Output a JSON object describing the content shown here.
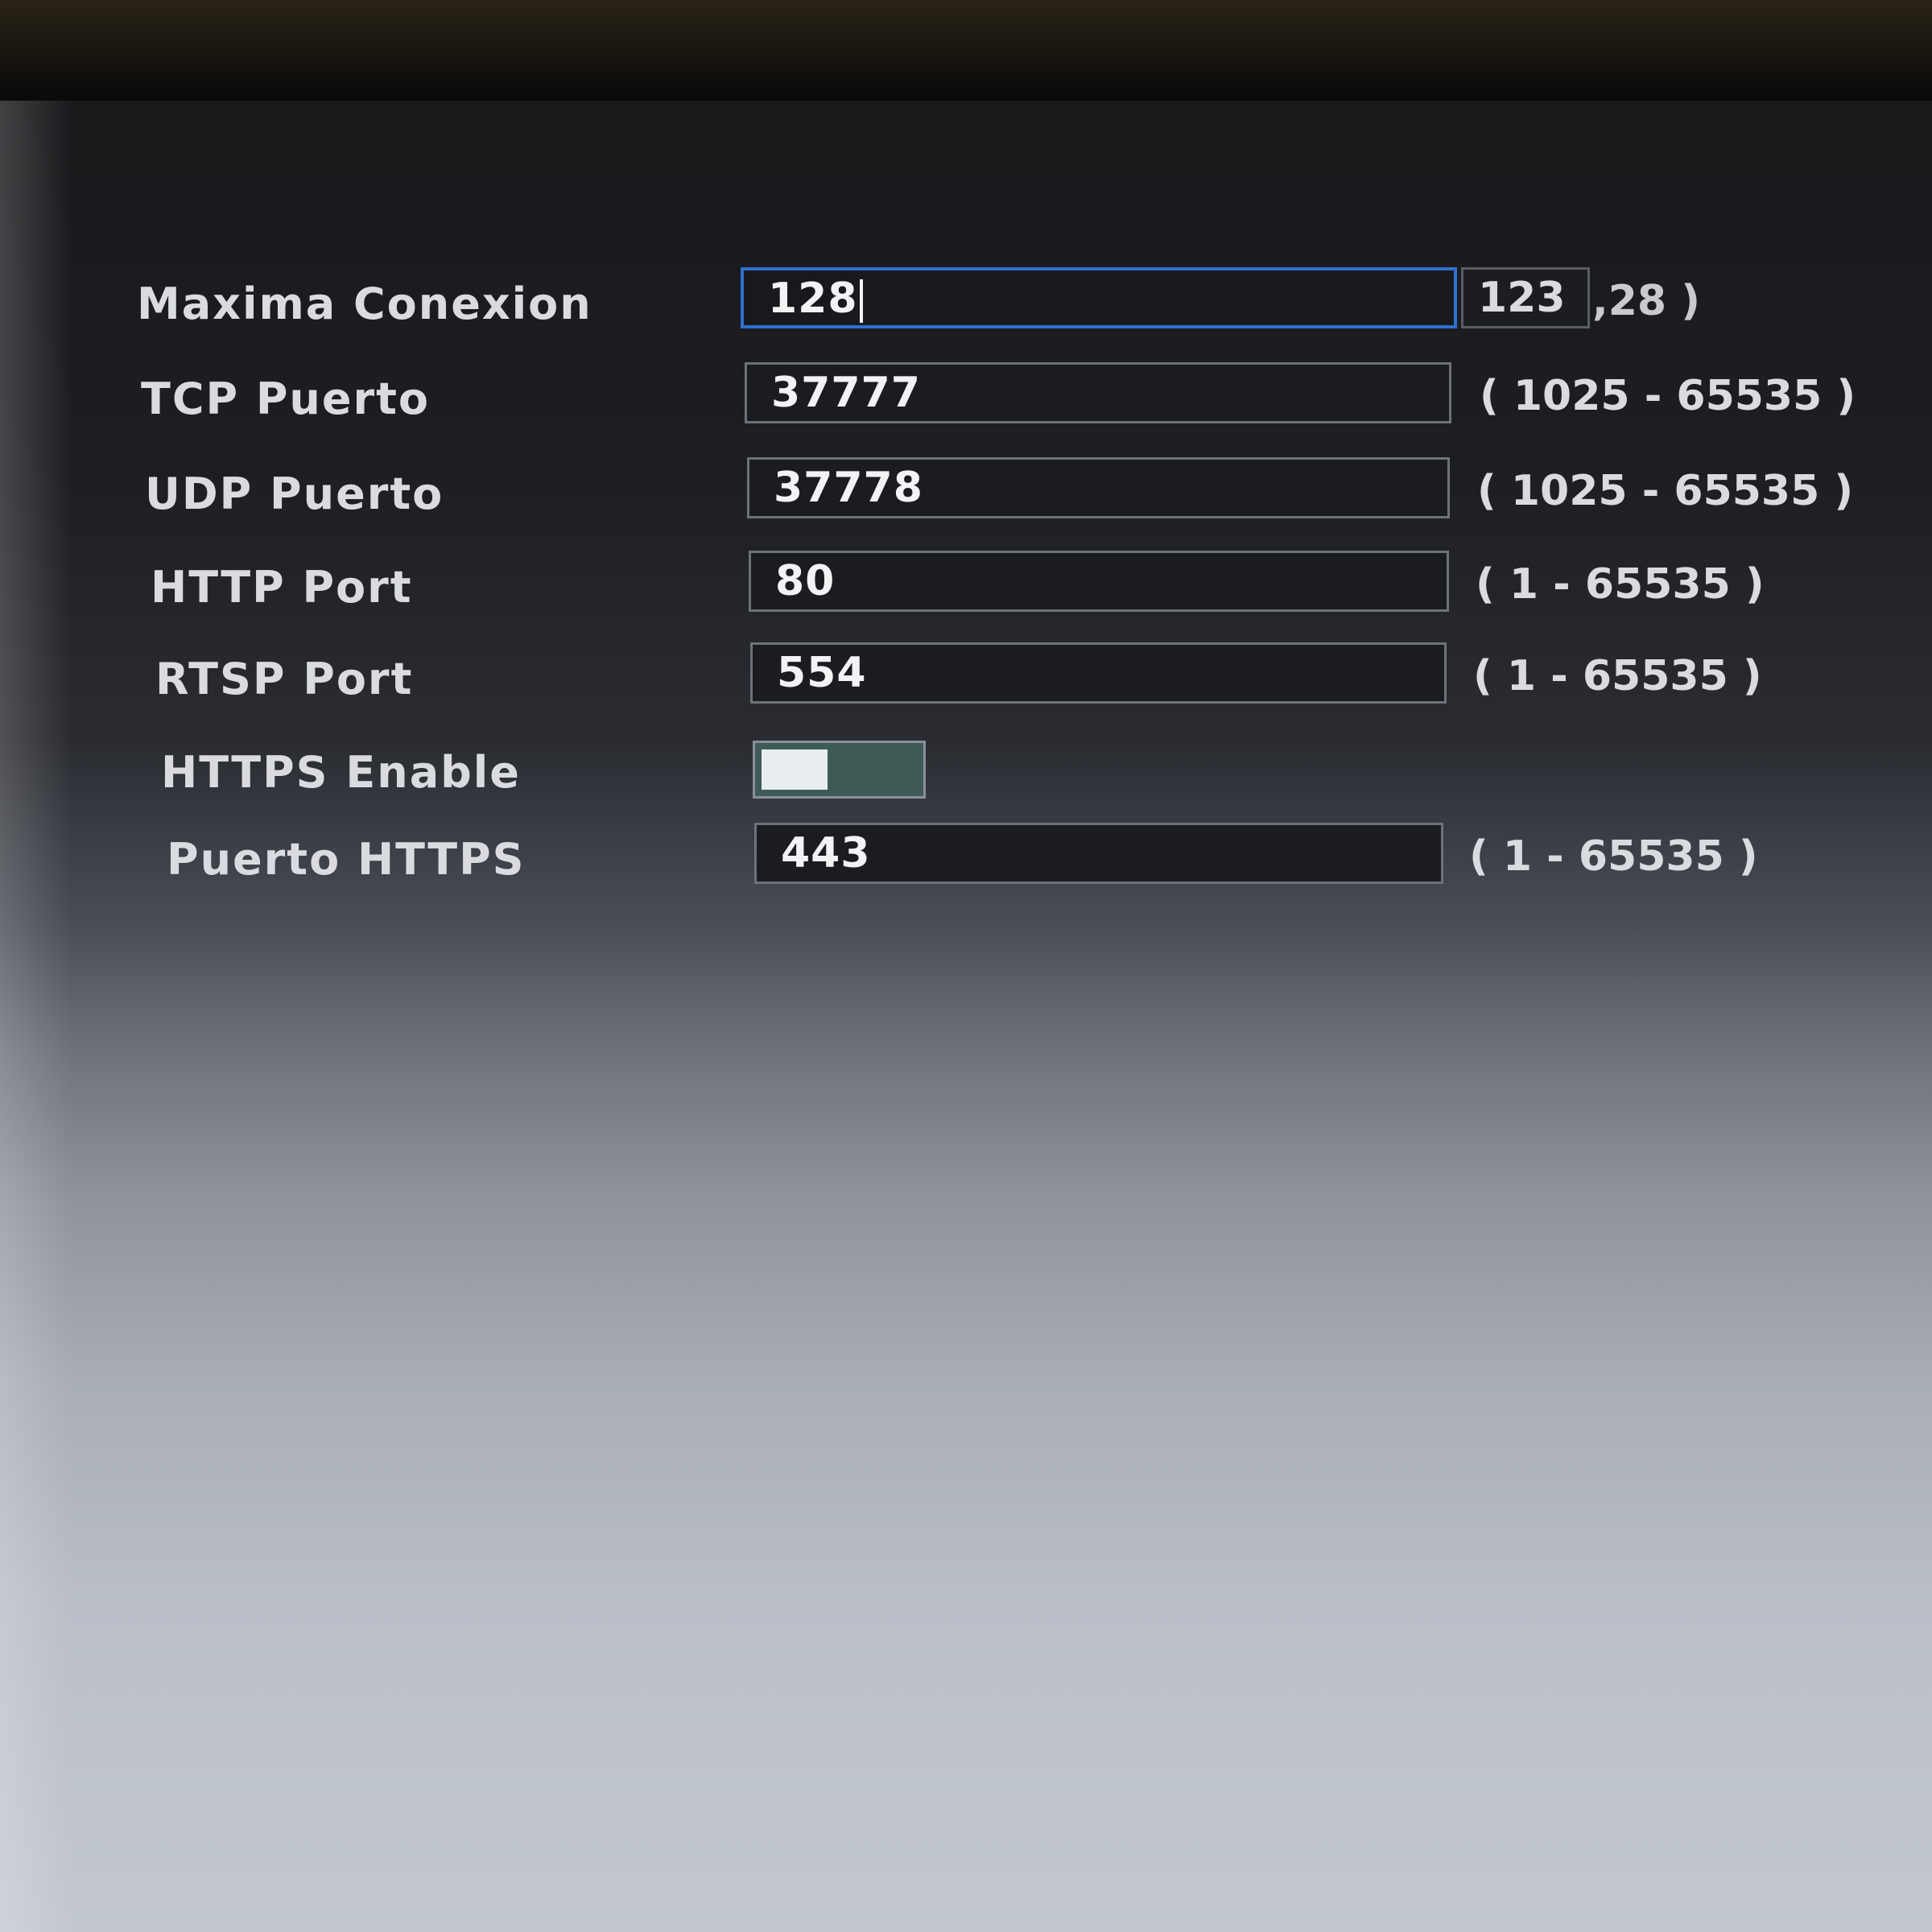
{
  "settings": [
    {
      "label": "Maxima Conexion",
      "value": "128",
      "range": "( 1 - 128 )",
      "active": true
    },
    {
      "label": "TCP Puerto",
      "value": "37777",
      "range": "( 1025 - 65535 )"
    },
    {
      "label": "UDP Puerto",
      "value": "37778",
      "range": "( 1025 - 65535 )"
    },
    {
      "label": "HTTP Port",
      "value": "80",
      "range": "( 1 - 65535 )"
    },
    {
      "label": "RTSP Port",
      "value": "554",
      "range": "( 1 - 65535 )"
    },
    {
      "label": "HTTPS Enable",
      "toggle_on": true
    },
    {
      "label": "Puerto HTTPS",
      "value": "443",
      "range": "( 1 - 65535 )"
    }
  ],
  "overlap": {
    "value": "123",
    "tail": ",28 )"
  },
  "colors": {
    "active_border": "#2f6fd0",
    "toggle_track": "#3e5b58",
    "toggle_knob": "#e8eef0"
  }
}
